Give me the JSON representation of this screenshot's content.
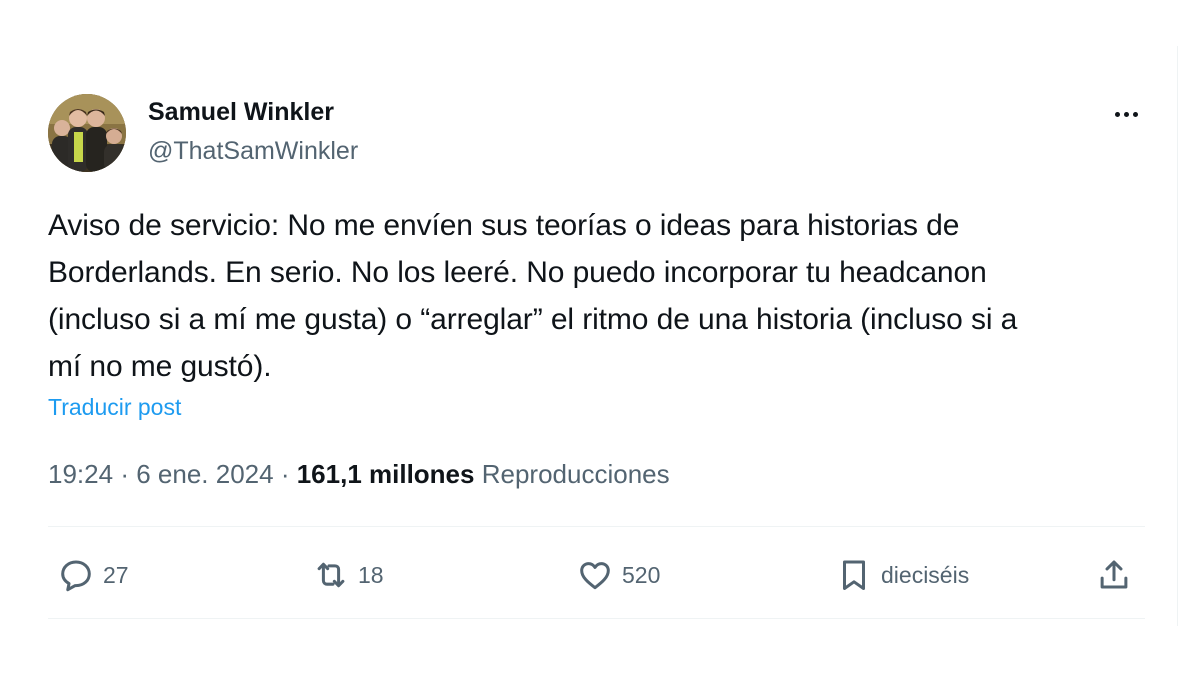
{
  "author": {
    "display_name": "Samuel Winkler",
    "handle": "@ThatSamWinkler",
    "avatar_icon": "group-photo-avatar"
  },
  "tweet": {
    "text_lines": [
      "Aviso de servicio: No me envíen sus teorías o ideas para historias de",
      "Borderlands. En serio. No los leeré. No puedo incorporar tu headcanon",
      "(incluso si a mí me gusta) o “arreglar” el ritmo de una historia (incluso si a",
      "mí no me gustó)."
    ],
    "translate_label": "Traducir post"
  },
  "meta": {
    "time": "19:24",
    "separator": "·",
    "date": "6 ene. 2024",
    "views_count": "161,1 millones",
    "views_label": "Reproducciones"
  },
  "actions": {
    "replies": "27",
    "reposts": "18",
    "likes": "520",
    "bookmarks": "dieciséis"
  },
  "colors": {
    "text_primary": "#0f1419",
    "text_secondary": "#536471",
    "link": "#1d9bf0",
    "divider": "#eff3f4"
  }
}
